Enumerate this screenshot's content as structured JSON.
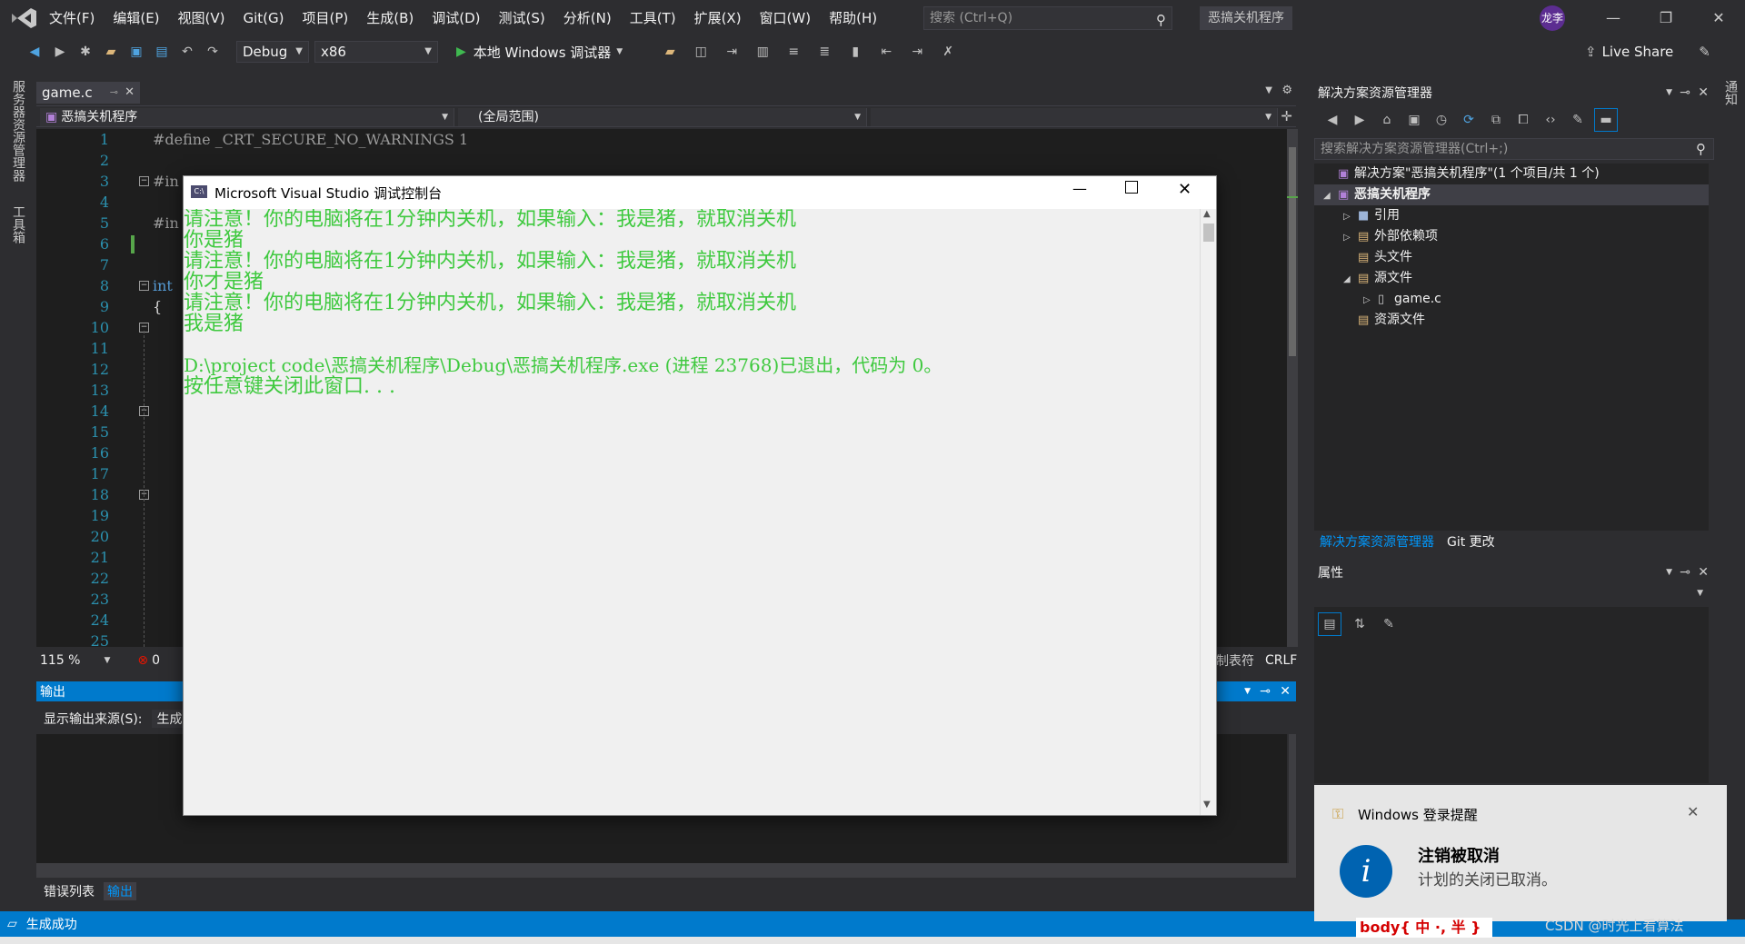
{
  "menu": [
    "文件(F)",
    "编辑(E)",
    "视图(V)",
    "Git(G)",
    "项目(P)",
    "生成(B)",
    "调试(D)",
    "测试(S)",
    "分析(N)",
    "工具(T)",
    "扩展(X)",
    "窗口(W)",
    "帮助(H)"
  ],
  "search": {
    "placeholder": "搜索 (Ctrl+Q)"
  },
  "solution_name": "恶搞关机程序",
  "user_initials": "龙李",
  "toolbar": {
    "config": "Debug",
    "platform": "x86",
    "run_label": "本地 Windows 调试器",
    "live_share": "Live Share"
  },
  "left_strip": {
    "items": [
      "服务器资源管理器",
      "工具箱"
    ]
  },
  "right_strip": {
    "items": [
      "通知"
    ]
  },
  "editor": {
    "tab": "game.c",
    "project_combo": "恶搞关机程序",
    "scope_combo": "(全局范围)",
    "line_numbers": [
      "1",
      "2",
      "3",
      "4",
      "5",
      "6",
      "7",
      "8",
      "9",
      "10",
      "11",
      "12",
      "13",
      "14",
      "15",
      "16",
      "17",
      "18",
      "19",
      "20",
      "21",
      "22",
      "23",
      "24",
      "25"
    ],
    "code": {
      "l1": "#define _CRT_SECURE_NO_WARNINGS 1",
      "l3": "#in",
      "l5": "#in",
      "l8": "int",
      "l9": "{"
    },
    "zoom": "115 %",
    "errors": "0",
    "tab_mode": "制表符",
    "line_ending": "CRLF"
  },
  "output": {
    "title": "输出",
    "source_label": "显示输出来源(S):",
    "source_value": "生成"
  },
  "bottom_tabs": [
    "错误列表",
    "输出"
  ],
  "status": {
    "text": "生成成功"
  },
  "solution_explorer": {
    "title": "解决方案资源管理器",
    "search_placeholder": "搜索解决方案资源管理器(Ctrl+;)",
    "items": [
      {
        "label": "解决方案\"恶搞关机程序\"(1 个项目/共 1 个)",
        "arrow": "",
        "icon": "▣"
      },
      {
        "label": "恶搞关机程序",
        "arrow": "◢",
        "icon": "▣"
      },
      {
        "label": "引用",
        "arrow": "▷",
        "icon": "■"
      },
      {
        "label": "外部依赖项",
        "arrow": "▷",
        "icon": "▤"
      },
      {
        "label": "头文件",
        "arrow": "",
        "icon": "▤"
      },
      {
        "label": "源文件",
        "arrow": "◢",
        "icon": "▤"
      },
      {
        "label": "game.c",
        "arrow": "▷",
        "icon": "▯"
      },
      {
        "label": "资源文件",
        "arrow": "",
        "icon": "▤"
      }
    ],
    "tabs": [
      "解决方案资源管理器",
      "Git 更改"
    ]
  },
  "properties": {
    "title": "属性"
  },
  "console": {
    "title": "Microsoft Visual Studio 调试控制台",
    "lines": [
      "请注意！你的电脑将在1分钟内关机，如果输入：我是猪，就取消关机",
      "你是猪",
      "请注意！你的电脑将在1分钟内关机，如果输入：我是猪，就取消关机",
      "你才是猪",
      "请注意！你的电脑将在1分钟内关机，如果输入：我是猪，就取消关机",
      "我是猪",
      "",
      "D:\\project code\\恶搞关机程序\\Debug\\恶搞关机程序.exe (进程 23768)已退出，代码为 0。",
      "按任意键关闭此窗口. . ."
    ],
    "text_color": "#3fc93f"
  },
  "toast": {
    "app": "Windows 登录提醒",
    "title": "注销被取消",
    "body": "计划的关闭已取消。"
  },
  "watermark": {
    "ime": "body{ 中 ·, 半 }",
    "csdn": "CSDN @时光上看算法"
  },
  "colors": {
    "accent": "#007acc",
    "console_text": "#3fc93f",
    "line_numbers": "#2b91af"
  }
}
